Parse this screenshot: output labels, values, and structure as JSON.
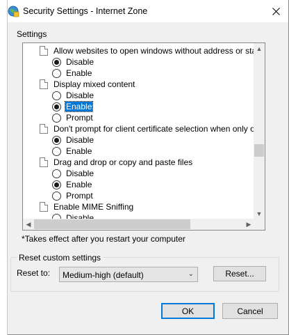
{
  "window": {
    "title": "Security Settings - Internet Zone"
  },
  "settings_label": "Settings",
  "list": {
    "rows": [
      {
        "kind": "setting",
        "label": "Allow websites to open windows without address or status ba"
      },
      {
        "kind": "option",
        "label": "Disable",
        "checked": true
      },
      {
        "kind": "option",
        "label": "Enable",
        "checked": false
      },
      {
        "kind": "setting",
        "label": "Display mixed content"
      },
      {
        "kind": "option",
        "label": "Disable",
        "checked": false
      },
      {
        "kind": "option",
        "label": "Enable",
        "checked": true,
        "selected": true
      },
      {
        "kind": "option",
        "label": "Prompt",
        "checked": false
      },
      {
        "kind": "setting",
        "label": "Don't prompt for client certificate selection when only one ce"
      },
      {
        "kind": "option",
        "label": "Disable",
        "checked": true
      },
      {
        "kind": "option",
        "label": "Enable",
        "checked": false
      },
      {
        "kind": "setting",
        "label": "Drag and drop or copy and paste files"
      },
      {
        "kind": "option",
        "label": "Disable",
        "checked": false
      },
      {
        "kind": "option",
        "label": "Enable",
        "checked": true
      },
      {
        "kind": "option",
        "label": "Prompt",
        "checked": false
      },
      {
        "kind": "setting",
        "label": "Enable MIME Sniffing"
      },
      {
        "kind": "option",
        "label": "Disable",
        "checked": false
      }
    ]
  },
  "note": "*Takes effect after you restart your computer",
  "reset_group": {
    "title": "Reset custom settings",
    "reset_to_label": "Reset to:",
    "selected_level": "Medium-high (default)",
    "reset_button": "Reset..."
  },
  "buttons": {
    "ok": "OK",
    "cancel": "Cancel"
  },
  "colors": {
    "selection": "#0078d7",
    "dialog_bg": "#f0f0f0"
  }
}
